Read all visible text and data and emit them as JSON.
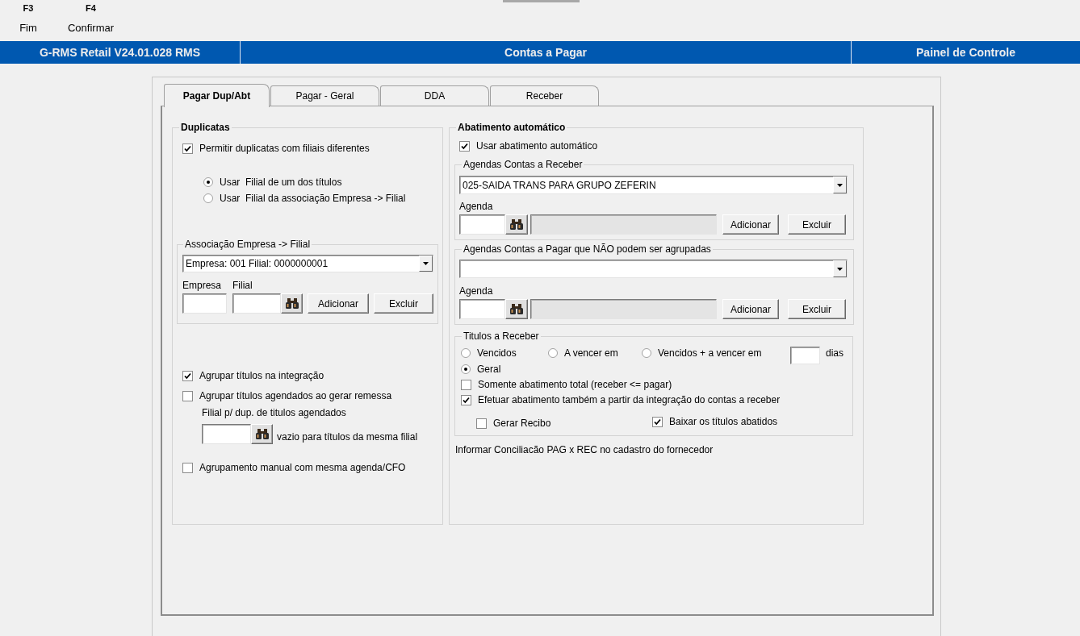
{
  "toolbar": [
    {
      "key": "F3",
      "label": "Fim"
    },
    {
      "key": "F4",
      "label": "Confirmar"
    }
  ],
  "header": {
    "app_title": "G-RMS Retail V24.01.028 RMS",
    "screen_title": "Contas a Pagar",
    "panel_link": "Painel de Controle"
  },
  "tabs": [
    {
      "label": "Pagar Dup/Abt",
      "selected": true
    },
    {
      "label": "Pagar - Geral",
      "selected": false
    },
    {
      "label": "DDA",
      "selected": false
    },
    {
      "label": "Receber",
      "selected": false
    }
  ],
  "duplicatas": {
    "title": "Duplicatas",
    "permitir": {
      "label": "Permitir duplicatas com filiais diferentes",
      "checked": true
    },
    "filial_options": [
      {
        "label": "Usar  Filial de um dos títulos",
        "selected": true
      },
      {
        "label": "Usar  Filial da associação Empresa -> Filial",
        "selected": false
      }
    ],
    "associacao": {
      "title": "Associação Empresa -> Filial",
      "combo_value": "Empresa: 001 Filial: 0000000001",
      "empresa_label": "Empresa",
      "filial_label": "Filial",
      "add_button": "Adicionar",
      "delete_button": "Excluir"
    },
    "agrupar_integracao": {
      "label": "Agrupar títulos na integração",
      "checked": true
    },
    "agrupar_remessa": {
      "label": "Agrupar títulos agendados ao gerar remessa",
      "checked": false
    },
    "filial_agendados_label": "Filial p/ dup. de titulos agendados",
    "filial_agendados_hint": "vazio para títulos da mesma filial",
    "agrupamento_manual": {
      "label": "Agrupamento manual com mesma agenda/CFO",
      "checked": false
    }
  },
  "abatimento": {
    "title": "Abatimento automático",
    "usar": {
      "label": "Usar abatimento automático",
      "checked": true
    },
    "agenda_groups": [
      {
        "title": "Agendas Contas a Receber",
        "combo_value": "025-SAIDA TRANS PARA GRUPO ZEFERIN",
        "agenda_label": "Agenda",
        "add_button": "Adicionar",
        "delete_button": "Excluir"
      },
      {
        "title": "Agendas Contas a Pagar que NÃO podem ser agrupadas",
        "agenda_label": "Agenda",
        "add_button": "Adicionar",
        "delete_button": "Excluir"
      }
    ],
    "titulos": {
      "title": "Titulos a Receber",
      "options": [
        {
          "label": "Vencidos",
          "selected": false
        },
        {
          "label": "A vencer em",
          "selected": false
        },
        {
          "label": "Vencidos + a vencer em",
          "selected": false
        },
        {
          "label": "Geral",
          "selected": true
        }
      ],
      "dias_label": "dias",
      "checks": [
        {
          "label": "Somente abatimento total (receber <= pagar)",
          "checked": false
        },
        {
          "label": "Efetuar abatimento também a partir da integração do contas a receber",
          "checked": true
        }
      ],
      "gerar_recibo": {
        "label": "Gerar Recibo",
        "checked": false
      },
      "baixar": {
        "label": "Baixar os títulos abatidos",
        "checked": true
      }
    },
    "note": "Informar Conciliacão PAG x REC no cadastro do fornecedor"
  }
}
